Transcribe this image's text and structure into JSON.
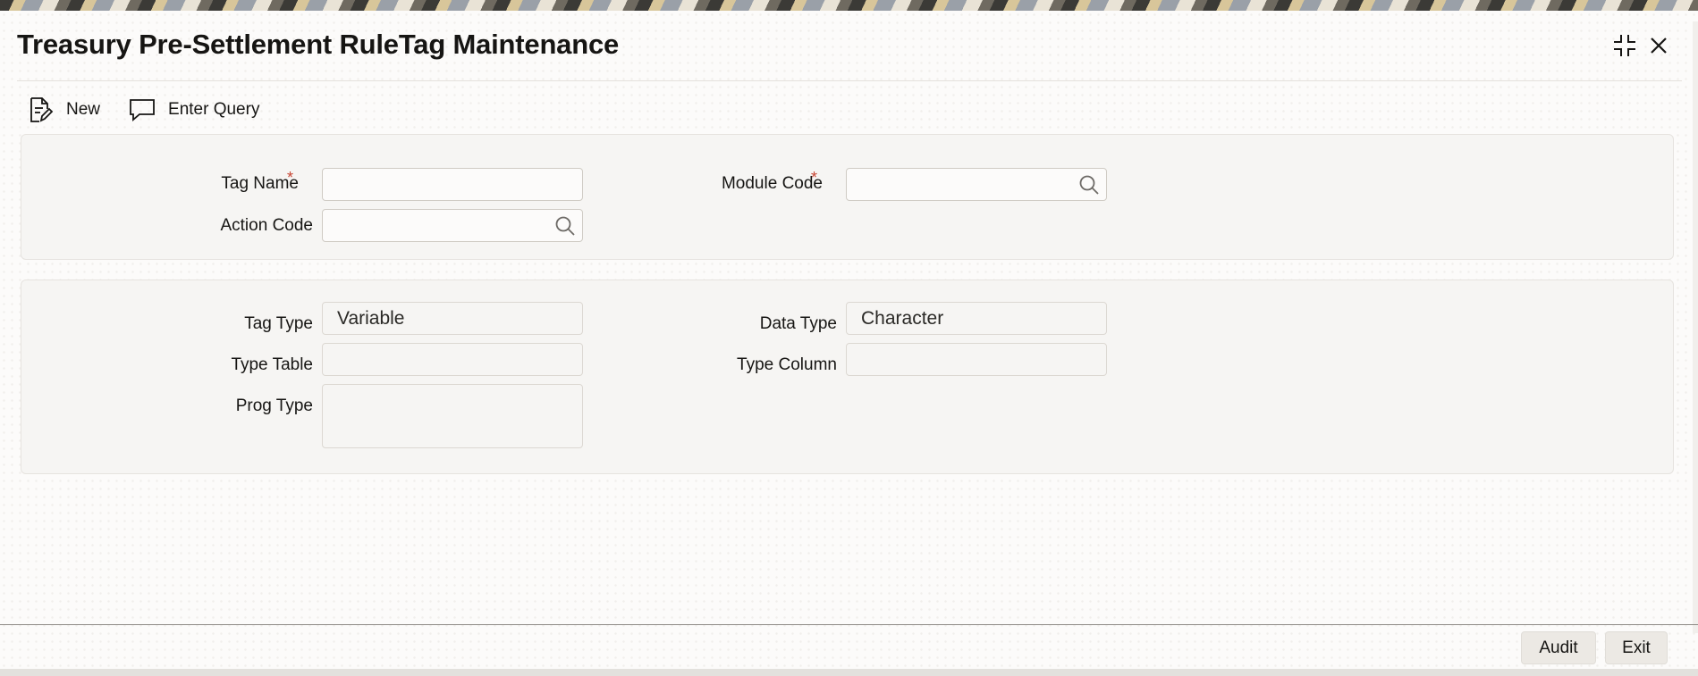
{
  "window": {
    "title": "Treasury Pre-Settlement RuleTag Maintenance",
    "controls": [
      "collapse-icon",
      "close-icon"
    ]
  },
  "toolbar": {
    "new_label": "New",
    "new_icon": "document-edit-icon",
    "enter_query_label": "Enter Query",
    "enter_query_icon": "chat-bubble-icon"
  },
  "header_section": {
    "tag_name": {
      "label": "Tag Name",
      "required": "*",
      "value": ""
    },
    "module_code": {
      "label": "Module Code",
      "required": "*",
      "value": ""
    },
    "action_code": {
      "label": "Action Code",
      "value": ""
    }
  },
  "detail_section": {
    "tag_type": {
      "label": "Tag Type",
      "value": "Variable"
    },
    "data_type": {
      "label": "Data Type",
      "value": "Character"
    },
    "type_table": {
      "label": "Type Table",
      "value": ""
    },
    "type_column": {
      "label": "Type Column",
      "value": ""
    },
    "prog_type": {
      "label": "Prog Type",
      "value": ""
    }
  },
  "footer": {
    "audit_label": "Audit",
    "exit_label": "Exit"
  },
  "colors": {
    "required_marker": "#c74634",
    "panel_bg": "#f6f5f3",
    "page_bg": "#fcfbfa",
    "button_bg": "#ece9e4"
  }
}
